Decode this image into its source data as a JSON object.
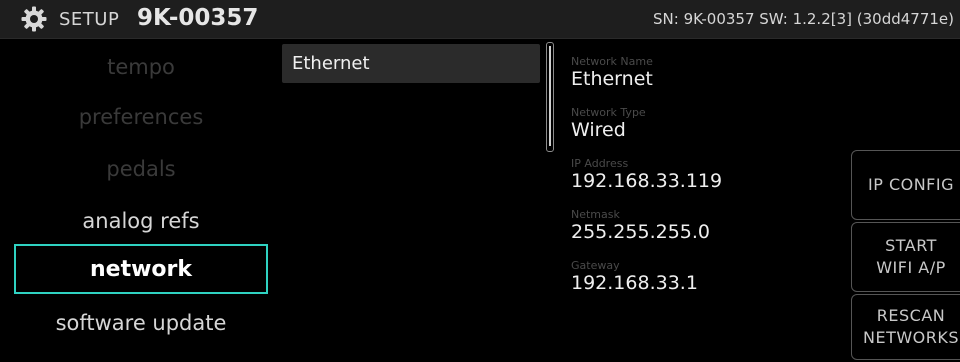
{
  "header": {
    "setup_label": "SETUP",
    "unit_id": "9K-00357",
    "serial_info": "SN: 9K-00357 SW: 1.2.2[3] (30dd4771e)"
  },
  "sidebar": {
    "items": [
      {
        "label": "tempo",
        "state": "disabled"
      },
      {
        "label": "preferences",
        "state": "disabled"
      },
      {
        "label": "pedals",
        "state": "disabled"
      },
      {
        "label": "analog refs",
        "state": "normal"
      },
      {
        "label": "network",
        "state": "selected"
      },
      {
        "label": "software update",
        "state": "normal"
      }
    ]
  },
  "networks": {
    "items": [
      {
        "label": "Ethernet"
      }
    ]
  },
  "details": {
    "name_label": "Network Name",
    "name_value": "Ethernet",
    "type_label": "Network Type",
    "type_value": "Wired",
    "ip_label": "IP Address",
    "ip_value": "192.168.33.119",
    "netmask_label": "Netmask",
    "netmask_value": "255.255.255.0",
    "gateway_label": "Gateway",
    "gateway_value": "192.168.33.1"
  },
  "actions": {
    "ip_config": "IP CONFIG",
    "start_wifi_line1": "START",
    "start_wifi_line2": "WIFI A/P",
    "rescan_line1": "RESCAN",
    "rescan_line2": "NETWORKS"
  },
  "colors": {
    "accent": "#2fd2c2",
    "title_bar": "#1e1e1e",
    "row_selected": "#2b2b2b"
  },
  "icons": {
    "settings": "gear-icon"
  }
}
